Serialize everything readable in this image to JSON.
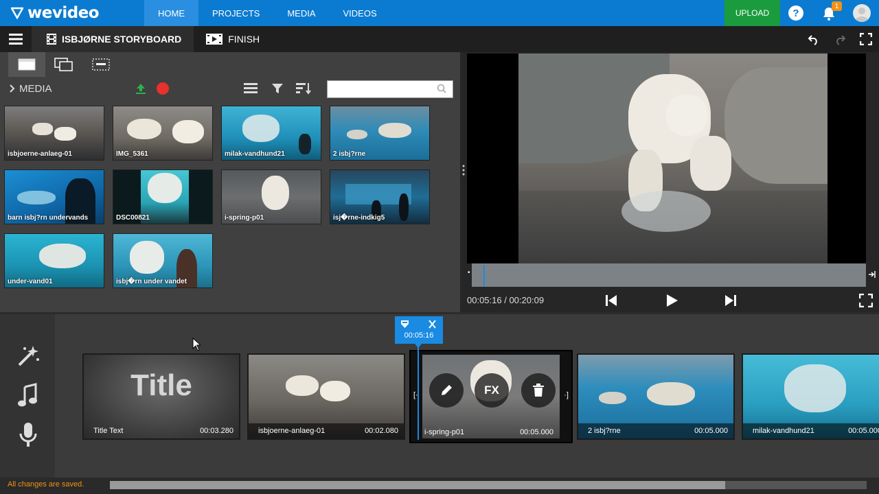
{
  "app": {
    "logo_text": "wevideo",
    "nav_tabs": [
      "HOME",
      "PROJECTS",
      "MEDIA",
      "VIDEOS"
    ],
    "active_tab": "HOME",
    "upload_label": "UPLOAD",
    "notification_count": "1",
    "help_label": "?"
  },
  "project": {
    "title": "ISBJØRNE STORYBOARD",
    "finish_label": "FINISH"
  },
  "media": {
    "section_title": "MEDIA",
    "search_placeholder": "",
    "thumbnails": [
      {
        "label": "isbjoerne-anlaeg-01"
      },
      {
        "label": "IMG_5361"
      },
      {
        "label": "milak-vandhund21"
      },
      {
        "label": "2 isbj?rne"
      },
      {
        "label": "barn isbj?rn undervands"
      },
      {
        "label": "DSC00821"
      },
      {
        "label": "i-spring-p01"
      },
      {
        "label": "isj�rne-indkig5"
      },
      {
        "label": "under-vand01"
      },
      {
        "label": "isbj�rn under vandet"
      }
    ]
  },
  "preview": {
    "current_time": "00:05:16",
    "total_time": "00:20:09",
    "time_display": "00:05:16 / 00:20:09",
    "playhead_fraction": 0.26
  },
  "timeline": {
    "playhead_time": "00:05:16",
    "clips": [
      {
        "name": "Title Text",
        "duration": "00:03.280",
        "title_overlay": "Title"
      },
      {
        "name": "isbjoerne-anlaeg-01",
        "duration": "00:02.080"
      },
      {
        "name": "i-spring-p01",
        "duration": "00:05.000",
        "fx_label": "FX"
      },
      {
        "name": "2 isbj?rne",
        "duration": "00:05.000"
      },
      {
        "name": "milak-vandhund21",
        "duration": "00:05.000"
      }
    ]
  },
  "status": {
    "saved_text": "All changes are saved."
  },
  "colors": {
    "brand_blue": "#0b7bd1",
    "upload_green": "#1a9c3e",
    "accent_orange": "#f29116",
    "record_red": "#e8302c"
  }
}
